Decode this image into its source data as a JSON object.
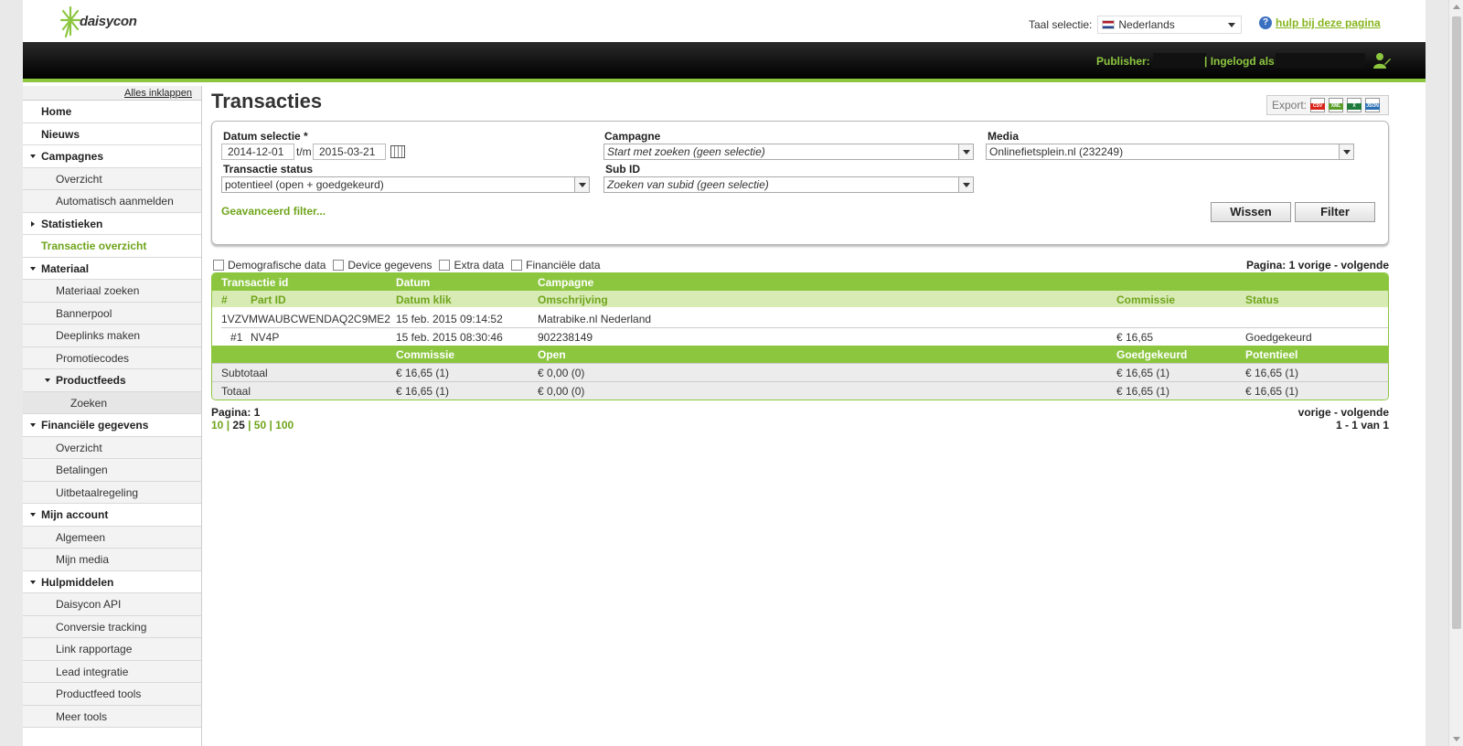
{
  "header": {
    "logo_text": "daisycon",
    "language_label": "Taal selectie:",
    "language_value": "Nederlands",
    "help_link": "hulp bij deze pagina",
    "publisher_label": "Publisher:",
    "logged_in_label": "| Ingelogd als:"
  },
  "sidebar": {
    "collapse_all": "Alles inklappen",
    "items": [
      {
        "label": "Home"
      },
      {
        "label": "Nieuws"
      },
      {
        "label": "Campagnes"
      },
      {
        "label": "Overzicht"
      },
      {
        "label": "Automatisch aanmelden"
      },
      {
        "label": "Statistieken"
      },
      {
        "label": "Transactie overzicht"
      },
      {
        "label": "Materiaal"
      },
      {
        "label": "Materiaal zoeken"
      },
      {
        "label": "Bannerpool"
      },
      {
        "label": "Deeplinks maken"
      },
      {
        "label": "Promotiecodes"
      },
      {
        "label": "Productfeeds"
      },
      {
        "label": "Zoeken"
      },
      {
        "label": "Financiële gegevens"
      },
      {
        "label": "Overzicht"
      },
      {
        "label": "Betalingen"
      },
      {
        "label": "Uitbetaalregeling"
      },
      {
        "label": "Mijn account"
      },
      {
        "label": "Algemeen"
      },
      {
        "label": "Mijn media"
      },
      {
        "label": "Hulpmiddelen"
      },
      {
        "label": "Daisycon API"
      },
      {
        "label": "Conversie tracking"
      },
      {
        "label": "Link rapportage"
      },
      {
        "label": "Lead integratie"
      },
      {
        "label": "Productfeed tools"
      },
      {
        "label": "Meer tools"
      }
    ]
  },
  "main": {
    "title": "Transacties",
    "export_label": "Export:",
    "export_formats": [
      "CSV",
      "XML",
      "X",
      "JSON"
    ]
  },
  "filter": {
    "date_label": "Datum selectie *",
    "date_from": "2014-12-01",
    "date_sep": "t/m",
    "date_to": "2015-03-21",
    "campaign_label": "Campagne",
    "campaign_value": "Start met zoeken (geen selectie)",
    "media_label": "Media",
    "media_value": "Onlinefietsplein.nl (232249)",
    "status_label": "Transactie status",
    "status_value": "potentieel (open + goedgekeurd)",
    "subid_label": "Sub ID",
    "subid_value": "Zoeken van subid (geen selectie)",
    "advanced": "Geavanceerd filter...",
    "clear_button": "Wissen",
    "filter_button": "Filter"
  },
  "options": {
    "demographic": "Demografische data",
    "device": "Device gegevens",
    "extra": "Extra data",
    "financial": "Financiële data",
    "page_info": "Pagina: 1  vorige - volgende"
  },
  "table": {
    "header1": {
      "transactie_id": "Transactie id",
      "datum": "Datum",
      "campagne": "Campagne"
    },
    "header2": {
      "hash": "#",
      "part_id": "Part ID",
      "datum_klik": "Datum klik",
      "omschrijving": "Omschrijving",
      "commissie": "Commissie",
      "status": "Status"
    },
    "row": {
      "transactie_id": "1VZVMWAUBCWENDAQ2C9ME2",
      "datum": "15 feb. 2015 09:14:52",
      "campagne": "Matrabike.nl Nederland",
      "part_num": "#1",
      "part_id": "NV4P",
      "datum_klik": "15 feb. 2015 08:30:46",
      "omschrijving": "902238149",
      "commissie": "€ 16,65",
      "status": "Goedgekeurd"
    },
    "summary_header": {
      "commissie": "Commissie",
      "open": "Open",
      "goedgekeurd": "Goedgekeurd",
      "potentieel": "Potentieel"
    },
    "subtotal": {
      "label": "Subtotaal",
      "commissie": "€ 16,65 (1)",
      "open": "€ 0,00 (0)",
      "goedgekeurd": "€ 16,65 (1)",
      "potentieel": "€ 16,65 (1)"
    },
    "total": {
      "label": "Totaal",
      "commissie": "€ 16,65 (1)",
      "open": "€ 0,00 (0)",
      "goedgekeurd": "€ 16,65 (1)",
      "potentieel": "€ 16,65 (1)"
    }
  },
  "pager": {
    "page": "Pagina: 1",
    "sizes": [
      "10",
      "25",
      "50",
      "100"
    ],
    "nav": "vorige - volgende",
    "range": "1 - 1 van 1"
  }
}
